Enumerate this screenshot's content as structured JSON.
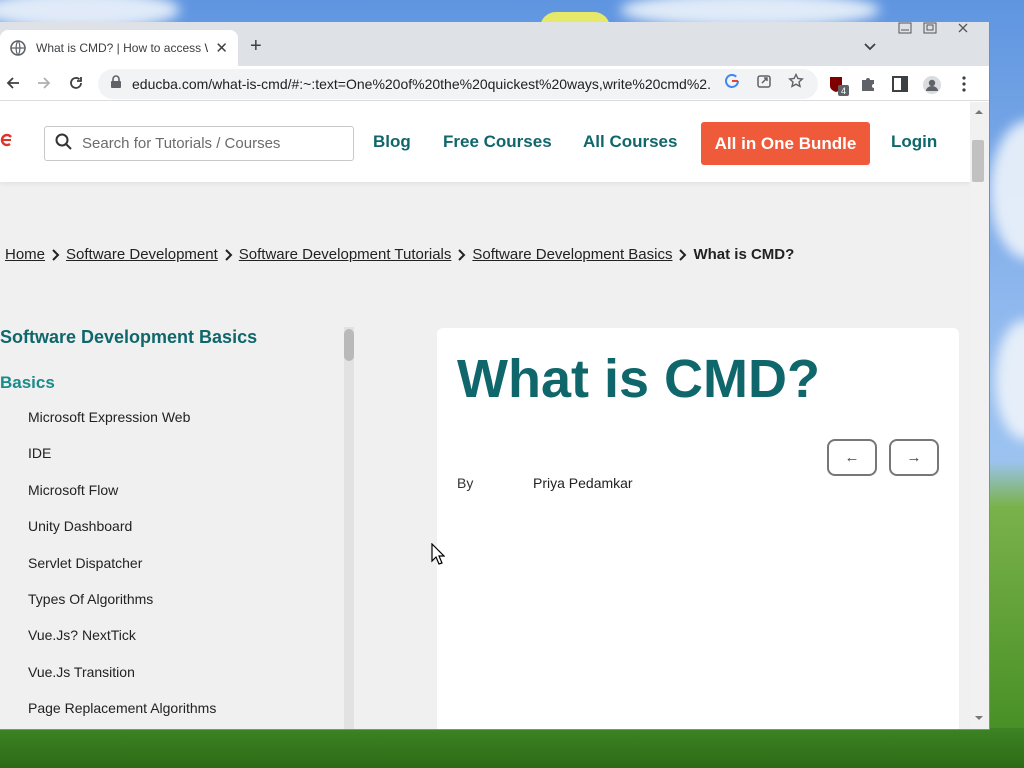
{
  "browser": {
    "tab_title": "What is CMD? | How to access W",
    "url": "educba.com/what-is-cmd/#:~:text=One%20of%20the%20quickest%20ways,write%20cmd%2...",
    "extension_badge": "4"
  },
  "site": {
    "search_placeholder": "Search for Tutorials / Courses",
    "nav": [
      "Blog",
      "Free Courses",
      "All Courses"
    ],
    "bundle_label": "All in One Bundle",
    "login_label": "Login",
    "accent_color": "#10676b",
    "bundle_color": "#ef5a3a"
  },
  "breadcrumb": {
    "items": [
      "Home",
      "Software Development",
      "Software Development Tutorials",
      "Software Development Basics"
    ],
    "current": "What is CMD?"
  },
  "sidebar": {
    "title": "Software Development Basics",
    "category": "Basics",
    "items": [
      "Microsoft Expression Web",
      "IDE",
      "Microsoft Flow",
      "Unity Dashboard",
      "Servlet Dispatcher",
      "Types Of Algorithms",
      "Vue.Js? NextTick",
      "Vue.Js Transition",
      "Page Replacement Algorithms"
    ]
  },
  "article": {
    "title": "What is CMD?",
    "by_label": "By",
    "author": "Priya Pedamkar",
    "prev_label": "←",
    "next_label": "→"
  }
}
